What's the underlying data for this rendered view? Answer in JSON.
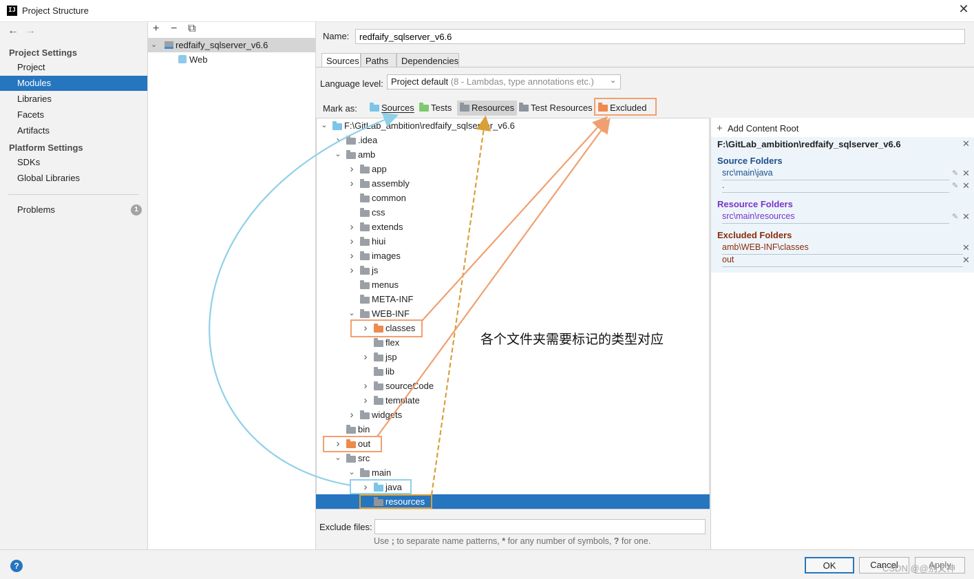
{
  "window": {
    "title": "Project Structure",
    "app_icon_text": "IJ",
    "close_glyph": "✕"
  },
  "nav": {
    "back": "←",
    "forward": "→",
    "project_settings_label": "Project Settings",
    "project_items": [
      "Project",
      "Modules",
      "Libraries",
      "Facets",
      "Artifacts"
    ],
    "selected": "Modules",
    "platform_settings_label": "Platform Settings",
    "platform_items": [
      "SDKs",
      "Global Libraries"
    ],
    "problems_label": "Problems",
    "problems_count": "1"
  },
  "modules": {
    "toolbar": [
      "+",
      "−",
      "⧉"
    ],
    "module_name": "redfaify_sqlserver_v6.6",
    "facet": "Web"
  },
  "detail": {
    "name_label": "Name:",
    "name_value": "redfaify_sqlserver_v6.6",
    "tabs": [
      "Sources",
      "Paths",
      "Dependencies"
    ],
    "active_tab": "Sources",
    "language_level_label": "Language level:",
    "language_level_value": "Project default",
    "language_level_hint": "(8 - Lambdas, type annotations etc.)",
    "mark_as_label": "Mark as:",
    "mark_as": [
      "Sources",
      "Tests",
      "Resources",
      "Test Resources",
      "Excluded"
    ],
    "exclude_files_label": "Exclude files:",
    "exclude_files_value": "",
    "exclude_hint_1": "Use ",
    "exclude_hint_2": ";",
    "exclude_hint_3": " to separate name patterns, ",
    "exclude_hint_4": "*",
    "exclude_hint_5": " for any number of symbols, ",
    "exclude_hint_6": "?",
    "exclude_hint_7": " for one."
  },
  "tree": [
    {
      "label": "F:\\GitLab_ambition\\redfaify_sqlserver_v6.6",
      "depth": 0,
      "expand": "open",
      "kind": "src"
    },
    {
      "label": ".idea",
      "depth": 1,
      "expand": "closed",
      "kind": "plain"
    },
    {
      "label": "amb",
      "depth": 1,
      "expand": "open",
      "kind": "plain"
    },
    {
      "label": "app",
      "depth": 2,
      "expand": "closed",
      "kind": "plain"
    },
    {
      "label": "assembly",
      "depth": 2,
      "expand": "closed",
      "kind": "plain"
    },
    {
      "label": "common",
      "depth": 2,
      "expand": "none",
      "kind": "plain"
    },
    {
      "label": "css",
      "depth": 2,
      "expand": "none",
      "kind": "plain"
    },
    {
      "label": "extends",
      "depth": 2,
      "expand": "closed",
      "kind": "plain"
    },
    {
      "label": "hiui",
      "depth": 2,
      "expand": "closed",
      "kind": "plain"
    },
    {
      "label": "images",
      "depth": 2,
      "expand": "closed",
      "kind": "plain"
    },
    {
      "label": "js",
      "depth": 2,
      "expand": "closed",
      "kind": "plain"
    },
    {
      "label": "menus",
      "depth": 2,
      "expand": "none",
      "kind": "plain"
    },
    {
      "label": "META-INF",
      "depth": 2,
      "expand": "none",
      "kind": "plain"
    },
    {
      "label": "WEB-INF",
      "depth": 2,
      "expand": "open",
      "kind": "plain"
    },
    {
      "label": "classes",
      "depth": 3,
      "expand": "closed",
      "kind": "exc"
    },
    {
      "label": "flex",
      "depth": 3,
      "expand": "none",
      "kind": "plain"
    },
    {
      "label": "jsp",
      "depth": 3,
      "expand": "closed",
      "kind": "plain"
    },
    {
      "label": "lib",
      "depth": 3,
      "expand": "none",
      "kind": "plain"
    },
    {
      "label": "sourceCode",
      "depth": 3,
      "expand": "closed",
      "kind": "plain"
    },
    {
      "label": "template",
      "depth": 3,
      "expand": "closed",
      "kind": "plain"
    },
    {
      "label": "widgets",
      "depth": 2,
      "expand": "closed",
      "kind": "plain"
    },
    {
      "label": "bin",
      "depth": 1,
      "expand": "none",
      "kind": "plain"
    },
    {
      "label": "out",
      "depth": 1,
      "expand": "closed",
      "kind": "exc"
    },
    {
      "label": "src",
      "depth": 1,
      "expand": "open",
      "kind": "plain"
    },
    {
      "label": "main",
      "depth": 2,
      "expand": "open",
      "kind": "plain"
    },
    {
      "label": "java",
      "depth": 3,
      "expand": "closed",
      "kind": "src"
    },
    {
      "label": "resources",
      "depth": 3,
      "expand": "none",
      "kind": "res",
      "selected": true
    }
  ],
  "roots": {
    "add_label": "Add Content Root",
    "root_path": "F:\\GitLab_ambition\\redfaify_sqlserver_v6.6",
    "source_folders_label": "Source Folders",
    "source_folders": [
      "src\\main\\java",
      "."
    ],
    "resource_folders_label": "Resource Folders",
    "resource_folders": [
      "src\\main\\resources"
    ],
    "excluded_folders_label": "Excluded Folders",
    "excluded_folders": [
      "amb\\WEB-INF\\classes",
      "out"
    ],
    "colors": {
      "source": "#1f4e8c",
      "resource": "#7a33c7",
      "excluded": "#8b2c0c"
    }
  },
  "annotation": {
    "text": "各个文件夹需要标记的类型对应",
    "colors": {
      "sources": "#8fd0e8",
      "resources": "#d9a03a",
      "excluded": "#f0a070"
    }
  },
  "footer": {
    "help": "?",
    "ok": "OK",
    "cancel": "Cancel",
    "apply": "Apply",
    "watermark": "CSDN @@别文神"
  }
}
